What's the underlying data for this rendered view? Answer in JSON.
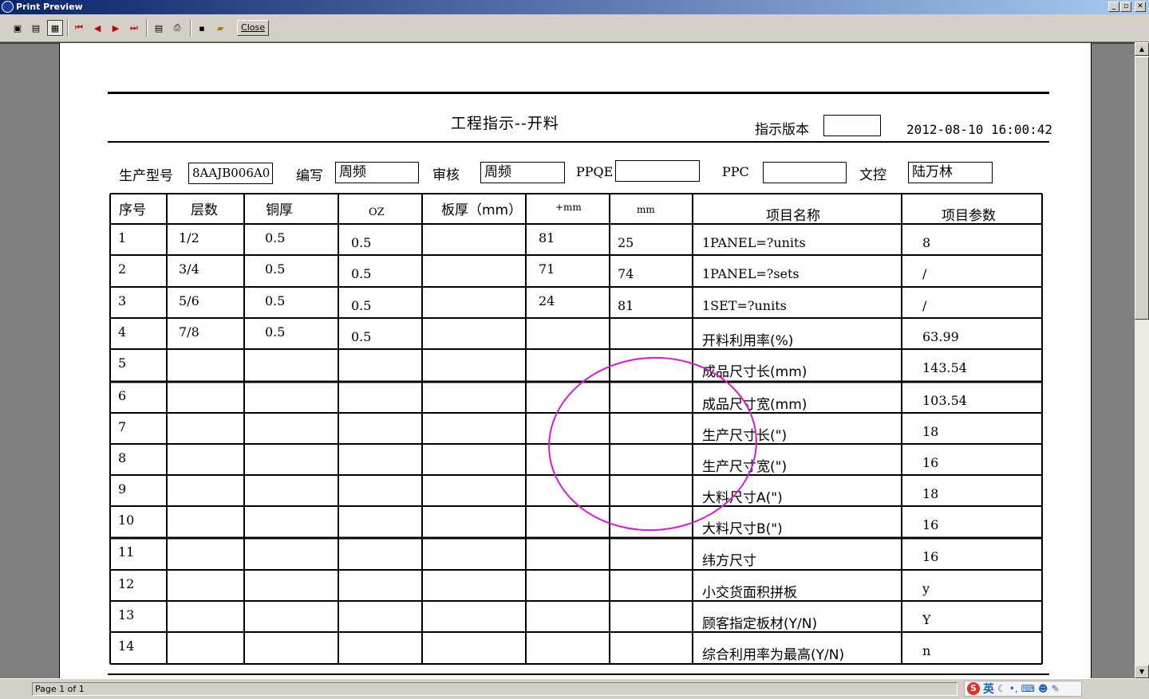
{
  "window": {
    "title": "Print Preview"
  },
  "toolbar": {
    "close_label": "Close",
    "icons": [
      "one-page-icon",
      "two-page-icon",
      "multi-page-icon",
      "first-page-icon",
      "prev-page-icon",
      "next-page-icon",
      "last-page-icon",
      "print-setup-icon",
      "print-icon",
      "save-icon",
      "open-icon"
    ]
  },
  "status": {
    "page": "Page 1 of 1",
    "ime_lang": "英"
  },
  "report": {
    "title": "工程指示--开料",
    "version_label": "指示版本",
    "version_value": "",
    "datetime": "2012-08-10 16:00:42",
    "fields": {
      "model_label": "生产型号",
      "model_value": "8AAJB006A0",
      "editor_label": "编写",
      "editor_value": "周频",
      "review_label": "审核",
      "review_value": "周频",
      "ppqe_label": "PPQE",
      "ppqe_value": "",
      "ppc_label": "PPC",
      "ppc_value": "",
      "doc_label": "文控",
      "doc_value": "陆万林"
    },
    "headers": [
      "序号",
      "层数",
      "铜厚",
      "OZ",
      "板厚（mm）",
      "+mm",
      "mm",
      "项目名称",
      "项目参数"
    ],
    "rows": [
      [
        "1",
        "1/2",
        "0.5",
        "0.5",
        "",
        "81",
        "25",
        "1PANEL=?units",
        "8"
      ],
      [
        "2",
        "3/4",
        "0.5",
        "0.5",
        "",
        "71",
        "74",
        "1PANEL=?sets",
        "/"
      ],
      [
        "3",
        "5/6",
        "0.5",
        "0.5",
        "",
        "24",
        "81",
        "1SET=?units",
        "/"
      ],
      [
        "4",
        "7/8",
        "0.5",
        "0.5",
        "",
        "",
        "",
        "开料利用率(%)",
        "63.99"
      ],
      [
        "5",
        "",
        "",
        "",
        "",
        "",
        "",
        "成品尺寸长(mm)",
        "143.54"
      ],
      [
        "6",
        "",
        "",
        "",
        "",
        "",
        "",
        "成品尺寸宽(mm)",
        "103.54"
      ],
      [
        "7",
        "",
        "",
        "",
        "",
        "",
        "",
        "生产尺寸长(\")",
        "18"
      ],
      [
        "8",
        "",
        "",
        "",
        "",
        "",
        "",
        "生产尺寸宽(\")",
        "16"
      ],
      [
        "9",
        "",
        "",
        "",
        "",
        "",
        "",
        "大料尺寸A(\")",
        "18"
      ],
      [
        "10",
        "",
        "",
        "",
        "",
        "",
        "",
        "大料尺寸B(\")",
        "16"
      ],
      [
        "11",
        "",
        "",
        "",
        "",
        "",
        "",
        "纬方尺寸",
        "16"
      ],
      [
        "12",
        "",
        "",
        "",
        "",
        "",
        "",
        "小交货面积拼板",
        "y"
      ],
      [
        "13",
        "",
        "",
        "",
        "",
        "",
        "",
        "顾客指定板材(Y/N)",
        "Y"
      ],
      [
        "14",
        "",
        "",
        "",
        "",
        "",
        "",
        "综合利用率为最高(Y/N)",
        "n"
      ]
    ]
  },
  "colors": {
    "titlebar_start": "#0a246a",
    "titlebar_end": "#a6caf0",
    "annotation": "#d81ad8",
    "face": "#d4d0c8"
  }
}
